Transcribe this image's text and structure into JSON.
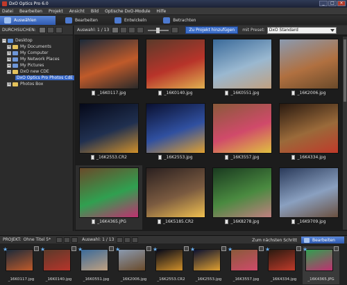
{
  "window": {
    "title": "DxO Optics Pro 6.0"
  },
  "menu": [
    "Datei",
    "Bearbeiten",
    "Projekt",
    "Ansicht",
    "Bild",
    "Optische DxO-Module",
    "Hilfe"
  ],
  "steps": [
    {
      "label": "Auswählen"
    },
    {
      "label": "Bearbeiten"
    },
    {
      "label": "Entwickeln"
    },
    {
      "label": "Betrachten"
    }
  ],
  "browse": {
    "label": "DURCHSUCHEN:",
    "tree": [
      {
        "label": "Desktop",
        "level": 0
      },
      {
        "label": "My Documents",
        "level": 1
      },
      {
        "label": "My Computer",
        "level": 1
      },
      {
        "label": "My Network Places",
        "level": 1
      },
      {
        "label": "My Pictures",
        "level": 1
      },
      {
        "label": "DxO new CDE",
        "level": 1
      },
      {
        "label": "DxO Optics Pro Photos CdE",
        "level": 2,
        "selected": true
      },
      {
        "label": "Photos Box",
        "level": 1
      }
    ]
  },
  "toolbar": {
    "selection": "Auswahl: 1 / 13",
    "add_project": "Zu Projekt hinzufügen",
    "preset_label": "mit Preset:",
    "preset_value": "DxO Standard"
  },
  "grid": [
    {
      "file": "_16K0117.jpg",
      "colors": [
        "#1b2a3a",
        "#c05a2a",
        "#2a2a2a"
      ]
    },
    {
      "file": "_16K0140.jpg",
      "colors": [
        "#5a3a2a",
        "#b8342a",
        "#e0b050"
      ]
    },
    {
      "file": "_16K0551.jpg",
      "colors": [
        "#3a6a9a",
        "#9ab8d0",
        "#c0a080"
      ]
    },
    {
      "file": "_16K2006.jpg",
      "colors": [
        "#8a9ab0",
        "#b07040",
        "#6a4a2a"
      ]
    },
    {
      "file": "_16K2553.CR2",
      "colors": [
        "#050818",
        "#203050",
        "#d0902a"
      ]
    },
    {
      "file": "_16K2553.jpg",
      "colors": [
        "#0a1030",
        "#3050a0",
        "#e0a030"
      ]
    },
    {
      "file": "_16K3557.jpg",
      "colors": [
        "#8a5a3a",
        "#d04a6a",
        "#e0c040"
      ]
    },
    {
      "file": "_16K4334.jpg",
      "colors": [
        "#2a1a10",
        "#9a6a3a",
        "#c03a2a"
      ]
    },
    {
      "file": "_16K4365.JPG",
      "colors": [
        "#6a4a2a",
        "#30a050",
        "#c03070"
      ],
      "selected": true
    },
    {
      "file": "_16K5185.CR2",
      "colors": [
        "#2a2020",
        "#7a5a40",
        "#f0c050"
      ]
    },
    {
      "file": "_16K8278.jpg",
      "colors": [
        "#1a3a20",
        "#4a8a40",
        "#c08080"
      ]
    },
    {
      "file": "_16K9709.jpg",
      "colors": [
        "#2a3a5a",
        "#8aa0c0",
        "#6a5040"
      ]
    }
  ],
  "project": {
    "label": "PROJEKT:",
    "name": "Ohne Titel 5*",
    "selection": "Auswahl: 1 / 13",
    "next_step": "Zum nächsten Schritt",
    "edit": "Bearbeiten"
  },
  "filmstrip": [
    {
      "file": "_16K0117.jpg",
      "colors": [
        "#1b2a3a",
        "#c05a2a"
      ]
    },
    {
      "file": "_16K0140.jpg",
      "colors": [
        "#5a3a2a",
        "#b8342a"
      ]
    },
    {
      "file": "_16K0551.jpg",
      "colors": [
        "#3a6a9a",
        "#c0a080"
      ]
    },
    {
      "file": "_16K2006.jpg",
      "colors": [
        "#8a9ab0",
        "#6a4a2a"
      ]
    },
    {
      "file": "_16K2553.CR2",
      "colors": [
        "#050818",
        "#d0902a"
      ]
    },
    {
      "file": "_16K2553.jpg",
      "colors": [
        "#0a1030",
        "#e0a030"
      ]
    },
    {
      "file": "_16K3557.jpg",
      "colors": [
        "#8a5a3a",
        "#d04a6a"
      ]
    },
    {
      "file": "_16K4334.jpg",
      "colors": [
        "#2a1a10",
        "#c03a2a"
      ]
    },
    {
      "file": "_16K4365.JPG",
      "colors": [
        "#30a050",
        "#c03070"
      ],
      "selected": true
    }
  ],
  "colors": {
    "accent": "#3d6fc9",
    "selection": "#3565c4",
    "star": "#6ab0f0"
  }
}
